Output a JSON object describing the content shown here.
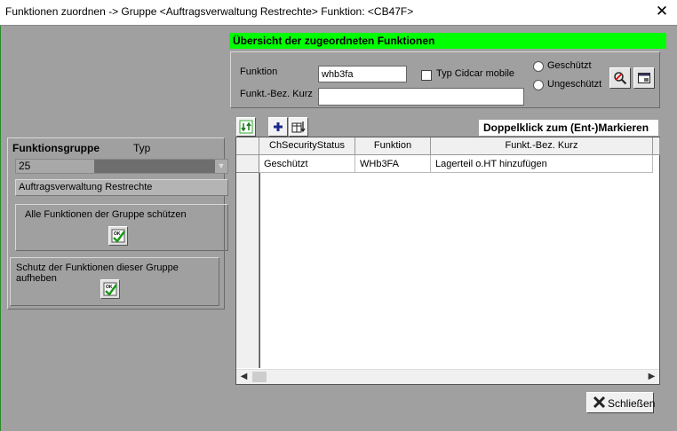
{
  "window": {
    "title": "Funktionen zuordnen -> Gruppe <Auftragsverwaltung Restrechte>  Funktion: <CB47F>",
    "close_glyph": "✕"
  },
  "left": {
    "group_heading": "Funktionsgruppe",
    "type_heading": "Typ",
    "group_value": "25",
    "group_name": "Auftragsverwaltung Restrechte",
    "protect_all_label": "Alle Funktionen der Gruppe schützen",
    "unprotect_all_label": "Schutz der Funktionen dieser Gruppe aufheben"
  },
  "right": {
    "header": "Übersicht der zugeordneten Funktionen",
    "funktion_label": "Funktion",
    "funktion_value": "whb3fa",
    "kurz_label": "Funkt.-Bez. Kurz",
    "kurz_value": "",
    "cidcar_label": "Typ Cidcar mobile",
    "protected_label": "Geschützt",
    "unprotected_label": "Ungeschützt",
    "hint": "Doppelklick zum (Ent-)Markieren"
  },
  "grid": {
    "columns": [
      "ChSecurityStatus",
      "Funktion",
      "Funkt.-Bez. Kurz"
    ],
    "rows": [
      [
        "Geschützt",
        "WHb3FA",
        "Lagerteil o.HT  hinzufügen"
      ]
    ]
  },
  "footer": {
    "close_label": "Schließen"
  },
  "colors": {
    "header_green": "#00ff00",
    "background": "#a0a0a0"
  }
}
